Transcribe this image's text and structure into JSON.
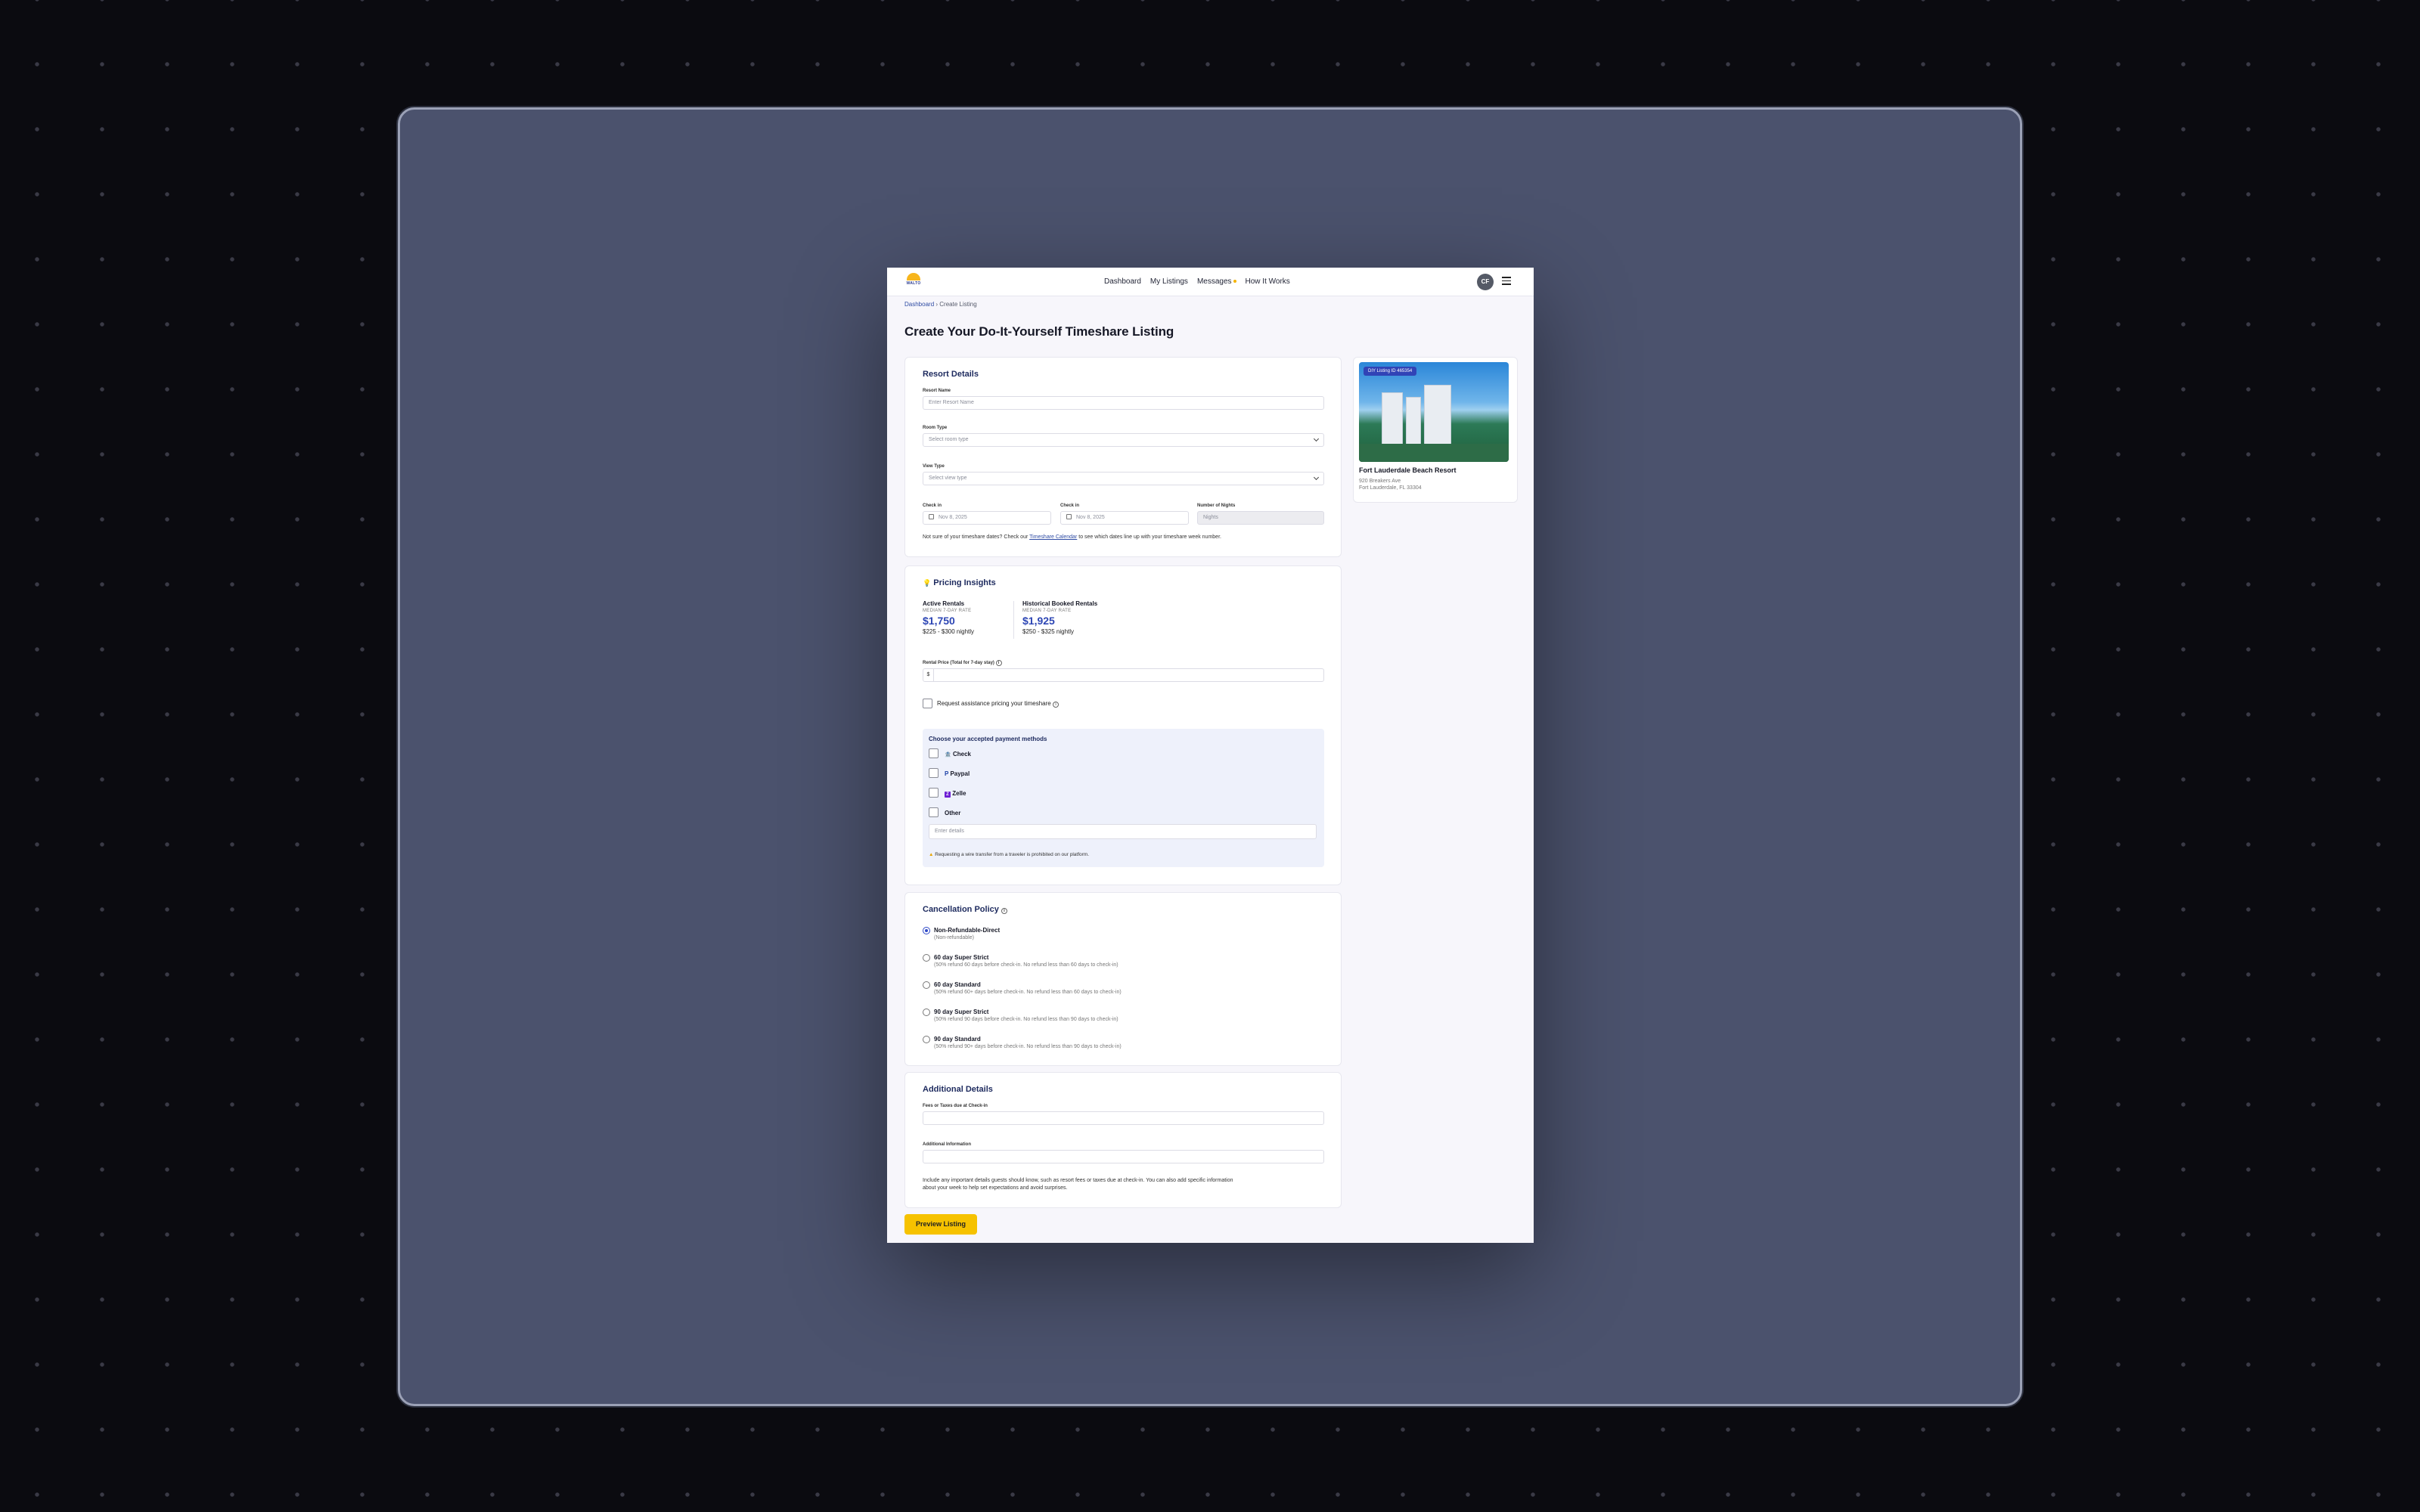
{
  "nav": {
    "brand": "WALTO",
    "links": [
      "Dashboard",
      "My Listings",
      "Messages",
      "How It Works"
    ],
    "avatar": "CF"
  },
  "breadcrumb": {
    "home": "Dashboard",
    "sep": "›",
    "current": "Create Listing"
  },
  "page_title": "Create Your Do-It-Yourself Timeshare Listing",
  "resort": {
    "title": "Resort Details",
    "resort_name_label": "Resort Name",
    "resort_name_placeholder": "Enter Resort Name",
    "room_type_label": "Room Type",
    "room_type_value": "Select room type",
    "view_type_label": "View Type",
    "view_type_value": "Select view type",
    "checkin_label": "Check in",
    "checkin_value": "Nov 8, 2025",
    "checkin2_label": "Check in",
    "checkin2_value": "Nov 8, 2025",
    "nights_label": "Number of Nights",
    "nights_placeholder": "Nights",
    "hint_pre": "Not sure of your timeshare dates? Check our",
    "hint_link": "Timeshare Calendar",
    "hint_post": "to see which dates line up with your timeshare week number."
  },
  "pricing": {
    "title": "Pricing Insights",
    "active_title": "Active Rentals",
    "active_sub": "MEDIAN 7-DAY RATE",
    "active_price": "$1,750",
    "active_range": "$225 - $300 nightly",
    "hist_title": "Historical Booked Rentals",
    "hist_sub": "MEDIAN 7-DAY RATE",
    "hist_price": "$1,925",
    "hist_range": "$250 - $325 nightly",
    "rental_label": "Rental Price (Total for 7-day stay)",
    "currency": "$",
    "assist_label": "Request assistance pricing your timeshare"
  },
  "payments": {
    "title": "Choose your accepted payment methods",
    "methods": [
      "Check",
      "Paypal",
      "Zelle",
      "Other"
    ],
    "details_placeholder": "Enter details",
    "warning": "Requesting a wire transfer from a traveler is prohibited on our platform."
  },
  "cancellation": {
    "title": "Cancellation Policy",
    "options": [
      {
        "name": "Non-Refundable-Direct",
        "desc": "(Non-refundable)"
      },
      {
        "name": "60 day Super Strict",
        "desc": "(50% refund 60 days before check-in. No refund less than 60 days to check-in)"
      },
      {
        "name": "60 day Standard",
        "desc": "(50% refund 60+ days before check-in. No refund less than 60 days to check-in)"
      },
      {
        "name": "90 day Super Strict",
        "desc": "(50% refund 90 days before check-in. No refund less than 90 days to check-in)"
      },
      {
        "name": "90 day Standard",
        "desc": "(50% refund 90+ days before check-in. No refund less than 90 days to check-in)"
      }
    ]
  },
  "additional": {
    "title": "Additional Details",
    "fees_label": "Fees or Taxes due at Check-in",
    "info_label": "Additional Information",
    "note1": "Include any important details guests should know, such as resort fees or taxes due at check-in. You can also add specific information",
    "note2": "about your week to help set expectations and avoid surprises."
  },
  "preview_button": "Preview Listing",
  "listing_card": {
    "badge": "DIY Listing ID 465354",
    "name": "Fort Lauderdale Beach Resort",
    "address1": "920 Breakers Ave",
    "address2": "Fort Lauderdale, FL 33304"
  }
}
